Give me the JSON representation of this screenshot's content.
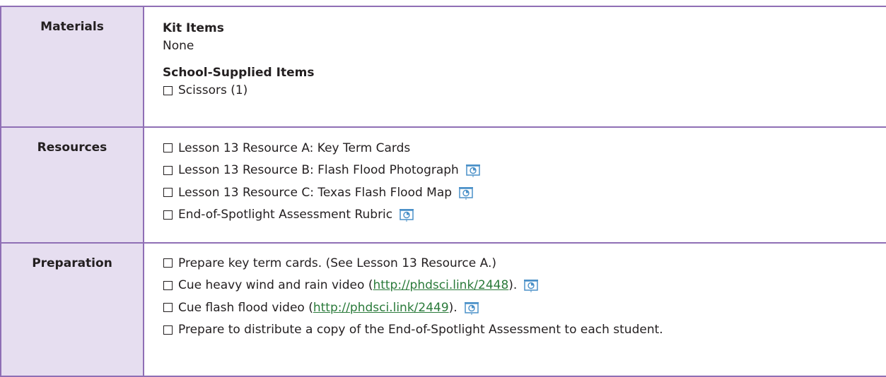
{
  "materials": {
    "label": "Materials",
    "kit_heading": "Kit Items",
    "kit_value": "None",
    "school_heading": "School-Supplied Items",
    "school_items": [
      "Scissors (1)"
    ]
  },
  "resources": {
    "label": "Resources",
    "items": [
      "Lesson 13 Resource A: Key Term Cards",
      "Lesson 13 Resource B: Flash Flood Photograph",
      "Lesson 13 Resource C: Texas Flash Flood Map",
      "End-of-Spotlight Assessment Rubric"
    ]
  },
  "preparation": {
    "label": "Preparation",
    "item1": "Prepare key term cards. (See Lesson 13 Resource A.)",
    "item2": {
      "before": "Cue heavy wind and rain video (",
      "link": "http://phdsci.link/2448",
      "after": ")."
    },
    "item3": {
      "before": "Cue flash flood video (",
      "link": "http://phdsci.link/2449",
      "after": ")."
    },
    "item4": "Prepare to distribute a copy of the End-of-Spotlight Assessment to each student."
  },
  "icon_names": {
    "projector": "projector-icon",
    "checkbox": "checkbox-icon"
  },
  "colors": {
    "border": "#8f6fb5",
    "label_bg": "#e6def0",
    "link": "#2a7a3a",
    "icon": "#4a90c8"
  }
}
